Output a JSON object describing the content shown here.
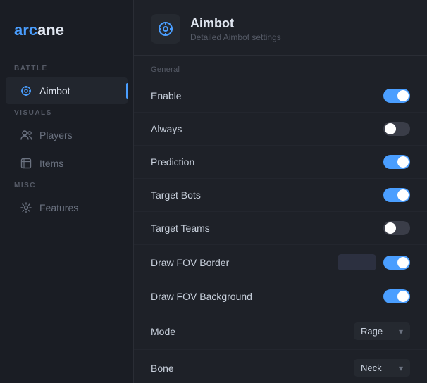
{
  "app": {
    "logo_prefix": "arc",
    "logo_suffix": "ane"
  },
  "sidebar": {
    "sections": [
      {
        "label": "BATTLE",
        "items": [
          {
            "id": "aimbot",
            "label": "Aimbot",
            "icon": "crosshair",
            "active": true
          }
        ]
      },
      {
        "label": "VISUALS",
        "items": [
          {
            "id": "players",
            "label": "Players",
            "icon": "users",
            "active": false
          },
          {
            "id": "items",
            "label": "Items",
            "icon": "calendar",
            "active": false
          }
        ]
      },
      {
        "label": "MISC",
        "items": [
          {
            "id": "features",
            "label": "Features",
            "icon": "gear",
            "active": false
          }
        ]
      }
    ]
  },
  "page": {
    "title": "Aimbot",
    "subtitle": "Detailed Aimbot settings",
    "section_label": "General",
    "settings": [
      {
        "id": "enable",
        "label": "Enable",
        "type": "toggle",
        "value": true
      },
      {
        "id": "always",
        "label": "Always",
        "type": "toggle",
        "value": false
      },
      {
        "id": "prediction",
        "label": "Prediction",
        "type": "toggle",
        "value": true
      },
      {
        "id": "target_bots",
        "label": "Target Bots",
        "type": "toggle",
        "value": true
      },
      {
        "id": "target_teams",
        "label": "Target Teams",
        "type": "toggle",
        "value": false
      },
      {
        "id": "draw_fov_border",
        "label": "Draw FOV Border",
        "type": "toggle_with_input",
        "input_value": "",
        "toggle_value": true
      },
      {
        "id": "draw_fov_background",
        "label": "Draw FOV Background",
        "type": "toggle",
        "value": true
      },
      {
        "id": "mode",
        "label": "Mode",
        "type": "dropdown",
        "value": "Rage"
      },
      {
        "id": "bone",
        "label": "Bone",
        "type": "dropdown",
        "value": "Neck"
      }
    ]
  }
}
